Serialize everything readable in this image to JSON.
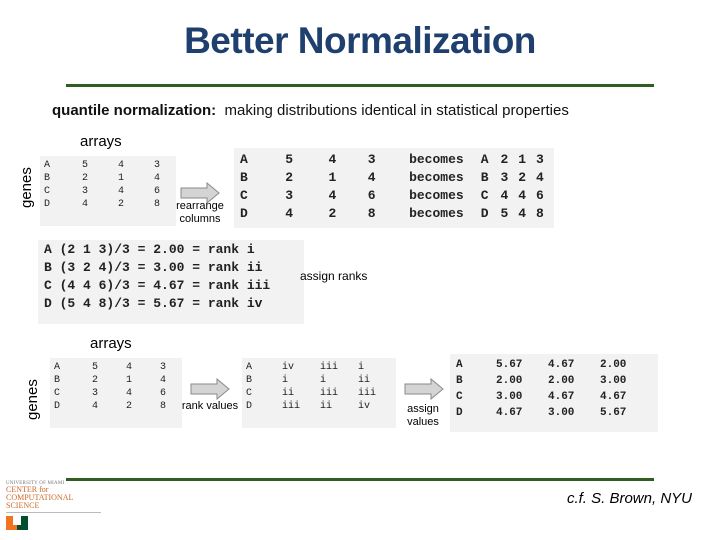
{
  "title": "Better Normalization",
  "subtitle": {
    "bold": "quantile normalization:",
    "rest": "making distributions identical in statistical properties"
  },
  "section1": {
    "arrays_label": "arrays",
    "genes_label": "genes",
    "original_table": [
      [
        "A",
        "5",
        "4",
        "3"
      ],
      [
        "B",
        "2",
        "1",
        "4"
      ],
      [
        "C",
        "3",
        "4",
        "6"
      ],
      [
        "D",
        "4",
        "2",
        "8"
      ]
    ],
    "arrow_caption": [
      "rearrange",
      "columns"
    ],
    "rearranged_table": [
      [
        "A",
        "5",
        "4",
        "3",
        "becomes",
        "A",
        "2",
        "1",
        "3"
      ],
      [
        "B",
        "2",
        "1",
        "4",
        "becomes",
        "B",
        "3",
        "2",
        "4"
      ],
      [
        "C",
        "3",
        "4",
        "6",
        "becomes",
        "C",
        "4",
        "4",
        "6"
      ],
      [
        "D",
        "4",
        "2",
        "8",
        "becomes",
        "D",
        "5",
        "4",
        "8"
      ]
    ],
    "rank_lines": [
      "A (2 1 3)/3 = 2.00 = rank i",
      "B (3 2 4)/3 = 3.00 = rank ii",
      "C (4 4 6)/3 = 4.67 = rank iii",
      "D (5 4 8)/3 = 5.67 = rank iv"
    ],
    "rank_caption": "assign ranks"
  },
  "section2": {
    "arrays_label": "arrays",
    "genes_label": "genes",
    "original_table": [
      [
        "A",
        "5",
        "4",
        "3"
      ],
      [
        "B",
        "2",
        "1",
        "4"
      ],
      [
        "C",
        "3",
        "4",
        "6"
      ],
      [
        "D",
        "4",
        "2",
        "8"
      ]
    ],
    "rank_values_caption": "rank values",
    "ranked_table": [
      [
        "A",
        "iv",
        "iii",
        "i"
      ],
      [
        "B",
        "i",
        "i",
        "ii"
      ],
      [
        "C",
        "ii",
        "iii",
        "iii"
      ],
      [
        "D",
        "iii",
        "ii",
        "iv"
      ]
    ],
    "assign_values_caption": [
      "assign",
      "values"
    ],
    "result_table": [
      [
        "A",
        "5.67",
        "4.67",
        "2.00"
      ],
      [
        "B",
        "2.00",
        "2.00",
        "3.00"
      ],
      [
        "C",
        "3.00",
        "4.67",
        "4.67"
      ],
      [
        "D",
        "4.67",
        "3.00",
        "5.67"
      ]
    ]
  },
  "footer": {
    "logo_university": "UNIVERSITY OF MIAMI",
    "logo_lines": [
      "CENTER for",
      "COMPUTATIONAL",
      "SCIENCE"
    ],
    "credit": "c.f. S. Brown, NYU"
  },
  "colors": {
    "title": "#1f3f6e",
    "rule": "#2e5e22",
    "panel_bg": "#f2f2f2",
    "logo_orange": "#f47321",
    "logo_green": "#005030"
  }
}
